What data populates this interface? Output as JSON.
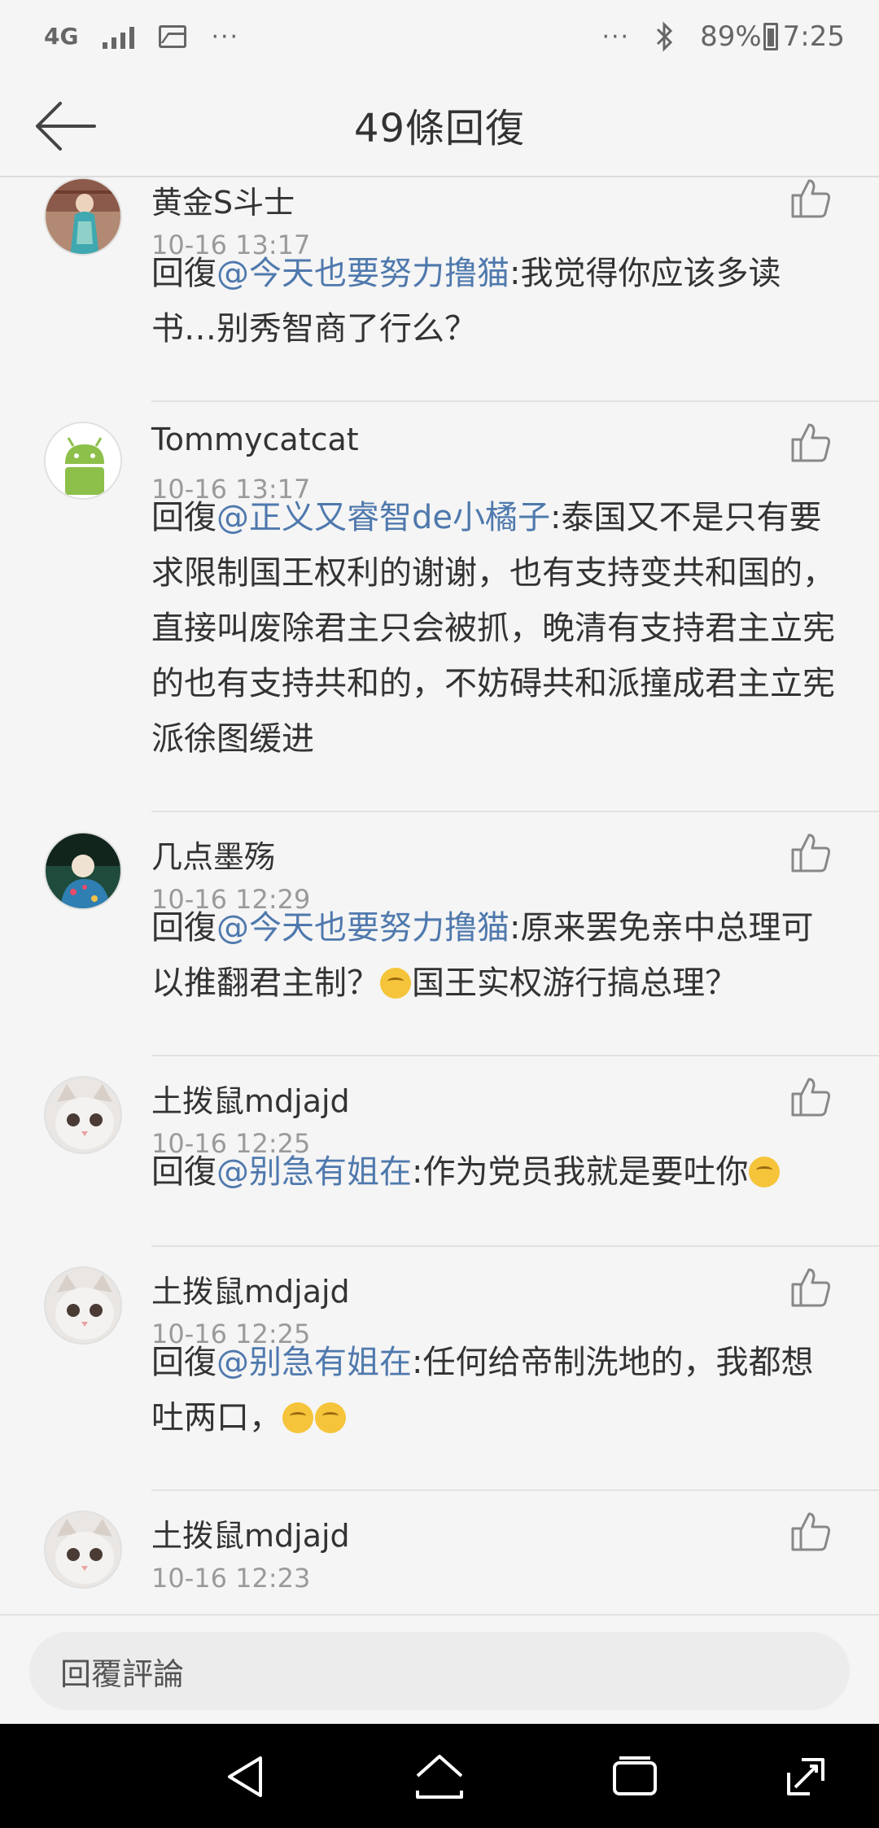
{
  "status_bar": {
    "network": "4G",
    "battery": "89%",
    "time": "7:25",
    "dots_left": "···",
    "dots_right": "···"
  },
  "header": {
    "title": "49條回復"
  },
  "comments": [
    {
      "username": "黄金S斗士",
      "time": "10-16 13:17",
      "reply_prefix": "回復",
      "mention": "@今天也要努力撸猫",
      "text": ":我觉得你应该多读书…别秀智商了行么？"
    },
    {
      "username": "Tommycatcat",
      "time": "10-16 13:17",
      "reply_prefix": "回復",
      "mention": "@正义又睿智de小橘子",
      "text": ":泰国又不是只有要求限制国王权利的谢谢，也有支持变共和国的，直接叫废除君主只会被抓，晚清有支持君主立宪的也有支持共和的，不妨碍共和派撞成君主立宪派徐图缓进"
    },
    {
      "username": "几点墨殇",
      "time": "10-16 12:29",
      "reply_prefix": "回復",
      "mention": "@今天也要努力撸猫",
      "text": ":原来罢免亲中总理可以推翻君主制？",
      "text2": "国王实权游行搞总理？"
    },
    {
      "username": "土拨鼠mdjajd",
      "time": "10-16 12:25",
      "reply_prefix": "回復",
      "mention": "@别急有姐在",
      "text": ":作为党员我就是要吐你"
    },
    {
      "username": "土拨鼠mdjajd",
      "time": "10-16 12:25",
      "reply_prefix": "回復",
      "mention": "@别急有姐在",
      "text": ":任何给帝制洗地的，我都想吐两口，"
    },
    {
      "username": "土拨鼠mdjajd",
      "time": "10-16 12:23"
    }
  ],
  "input": {
    "placeholder": "回覆評論"
  },
  "colors": {
    "mention": "#4f79ad",
    "background": "#f5f5f5",
    "time": "#9a9a9a",
    "nav": "#000000"
  },
  "icons": [
    "back-arrow-icon",
    "thumbs-up-icon",
    "nav-back-icon",
    "nav-home-icon",
    "nav-recents-icon",
    "nav-expand-icon"
  ]
}
